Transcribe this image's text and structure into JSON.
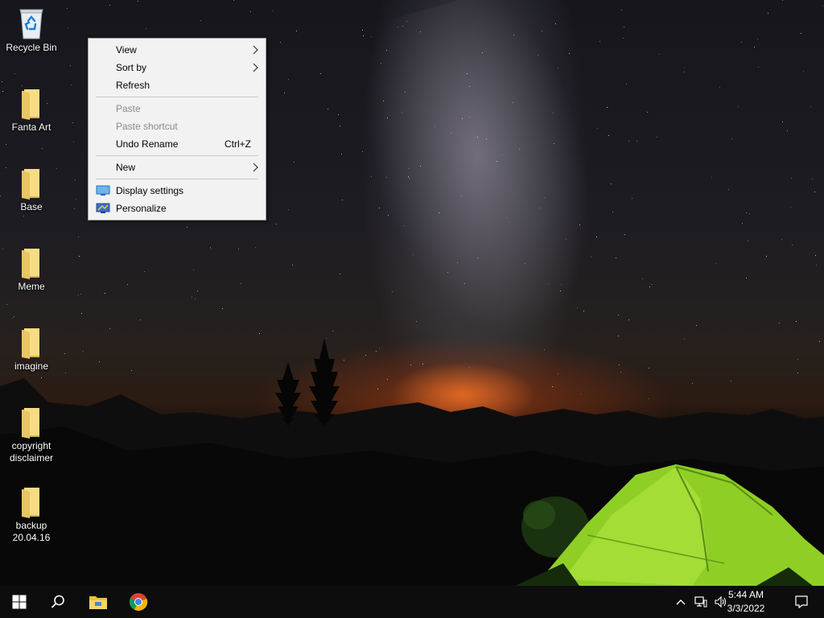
{
  "desktop": {
    "icons": [
      {
        "label": "Recycle Bin",
        "icon": "recycle-bin-icon"
      },
      {
        "label": "Fanta Art",
        "icon": "folder-icon"
      },
      {
        "label": "Base",
        "icon": "folder-icon"
      },
      {
        "label": "Meme",
        "icon": "folder-icon"
      },
      {
        "label": "imagine",
        "icon": "folder-icon"
      },
      {
        "label": "copyright\ndisclaimer",
        "icon": "folder-icon"
      },
      {
        "label": "backup\n20.04.16",
        "icon": "folder-icon"
      }
    ]
  },
  "context_menu": {
    "view": "View",
    "sort_by": "Sort by",
    "refresh": "Refresh",
    "paste": "Paste",
    "paste_shortcut": "Paste shortcut",
    "undo_rename": "Undo Rename",
    "undo_rename_shortcut": "Ctrl+Z",
    "new": "New",
    "display_settings": "Display settings",
    "personalize": "Personalize"
  },
  "taskbar": {
    "buttons": [
      "start-windows-icon",
      "search-icon",
      "file-explorer-icon",
      "chrome-icon"
    ],
    "tray_icons": [
      "chevron-up-icon",
      "network-icon",
      "volume-icon",
      "notification-icon"
    ],
    "time": "5:44 AM",
    "date": "3/3/2022"
  },
  "colors": {
    "taskbar": "#0d0d0d",
    "menu_bg": "#f2f2f2",
    "folder": "#f5d77a",
    "tent": "#9ad62a"
  }
}
